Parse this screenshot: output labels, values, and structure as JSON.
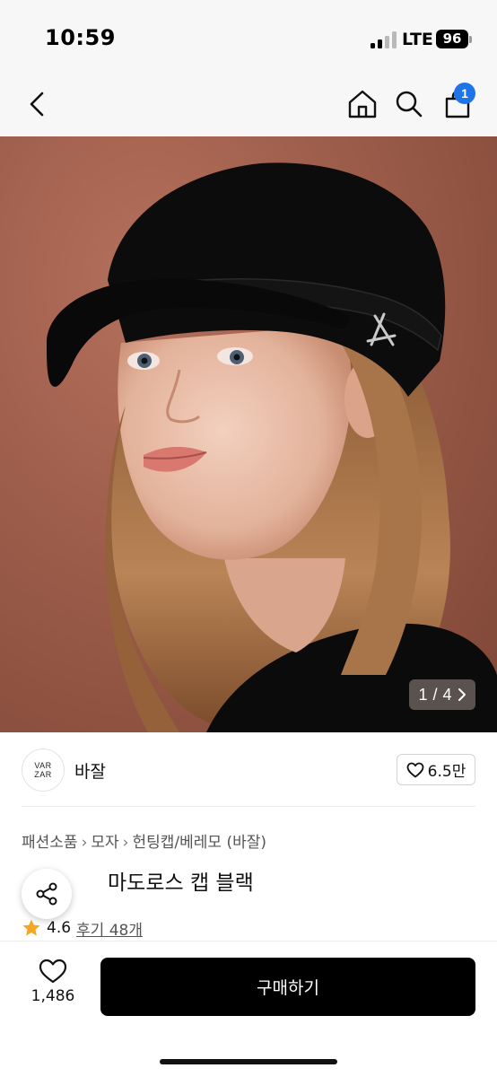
{
  "status_bar": {
    "time": "10:59",
    "network": "LTE",
    "battery": "96"
  },
  "nav": {
    "back_icon": "chevron-left-icon",
    "home_icon": "home-icon",
    "search_icon": "search-icon",
    "bag_icon": "shopping-bag-icon",
    "cart_badge": "1",
    "badge_color": "#1f74e8"
  },
  "hero": {
    "pager_current": "1",
    "pager_sep": "/",
    "pager_total": "4",
    "pager_icon": "chevron-right-icon"
  },
  "brand": {
    "logo_line1": "VAR",
    "logo_line2": "ZAR",
    "name": "바잘",
    "likes": "6.5만"
  },
  "product": {
    "breadcrumb": [
      "패션소품",
      "모자",
      "헌팅캡/베레모 (바잘)"
    ],
    "title": "마도로스 캡 블랙",
    "rating": "4.6",
    "reviews": "후기 48개",
    "star_color": "#f5a623"
  },
  "bottom": {
    "wish_count": "1,486",
    "buy_label": "구매하기"
  }
}
